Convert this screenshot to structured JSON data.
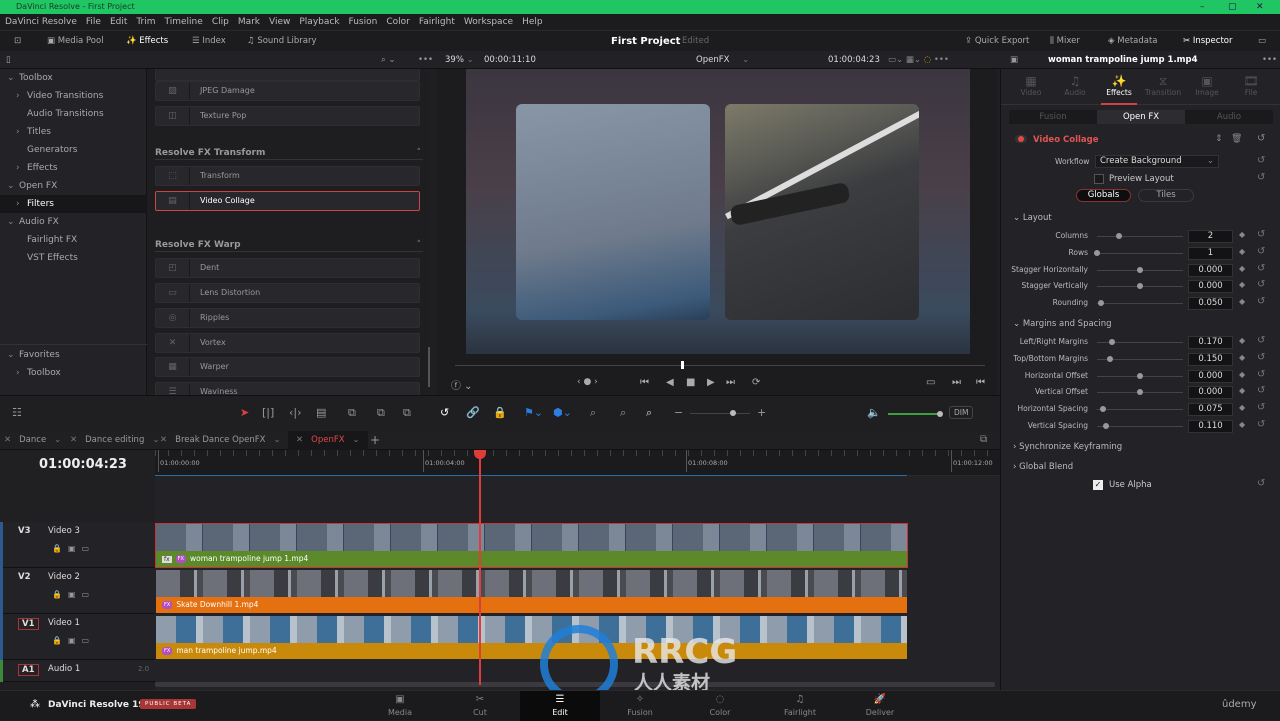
{
  "window": {
    "title": "DaVinci Resolve - First Project",
    "accent": "#1fc663"
  },
  "menu": [
    "DaVinci Resolve",
    "File",
    "Edit",
    "Trim",
    "Timeline",
    "Clip",
    "Mark",
    "View",
    "Playback",
    "Fusion",
    "Color",
    "Fairlight",
    "Workspace",
    "Help"
  ],
  "toolbar": {
    "media_pool": "Media Pool",
    "effects": "Effects",
    "index": "Index",
    "sound_library": "Sound Library",
    "project": "First Project",
    "status": "Edited",
    "quick_export": "Quick Export",
    "mixer": "Mixer",
    "metadata": "Metadata",
    "inspector": "Inspector"
  },
  "viewer_bar": {
    "zoom": "39%",
    "source_tc": "00:00:11:10",
    "timeline_name": "OpenFX",
    "record_tc": "01:00:04:23"
  },
  "tree": [
    {
      "label": "Toolbox",
      "arrow": "⌄",
      "indent": 0
    },
    {
      "label": "Video Transitions",
      "arrow": "›",
      "indent": 1
    },
    {
      "label": "Audio Transitions",
      "arrow": "",
      "indent": 1
    },
    {
      "label": "Titles",
      "arrow": "›",
      "indent": 1
    },
    {
      "label": "Generators",
      "arrow": "",
      "indent": 1
    },
    {
      "label": "Effects",
      "arrow": "›",
      "indent": 1
    },
    {
      "label": "Open FX",
      "arrow": "⌄",
      "indent": 0
    },
    {
      "label": "Filters",
      "arrow": "›",
      "indent": 1,
      "selected": true
    },
    {
      "label": "Audio FX",
      "arrow": "⌄",
      "indent": 0
    },
    {
      "label": "Fairlight FX",
      "arrow": "",
      "indent": 1
    },
    {
      "label": "VST Effects",
      "arrow": "",
      "indent": 1
    }
  ],
  "favorites": {
    "label": "Favorites",
    "items": [
      "Toolbox"
    ]
  },
  "fx": {
    "top_items": [
      "JPEG Damage",
      "Texture Pop"
    ],
    "groups": [
      {
        "title": "Resolve FX Transform",
        "items": [
          "Transform",
          "Video Collage"
        ]
      },
      {
        "title": "Resolve FX Warp",
        "items": [
          "Dent",
          "Lens Distortion",
          "Ripples",
          "Vortex",
          "Warper",
          "Waviness"
        ]
      }
    ],
    "selected": "Video Collage"
  },
  "inspector": {
    "clip": "woman trampoline jump 1.mp4",
    "tabs": [
      {
        "label": "Video",
        "icon": "▦"
      },
      {
        "label": "Audio",
        "icon": "♫"
      },
      {
        "label": "Effects",
        "icon": "✨",
        "active": true
      },
      {
        "label": "Transition",
        "icon": "⧖"
      },
      {
        "label": "Image",
        "icon": "▣"
      },
      {
        "label": "File",
        "icon": "🎞"
      }
    ],
    "subtabs": [
      "Fusion",
      "Open FX",
      "Audio"
    ],
    "effect": "Video Collage",
    "workflow_label": "Workflow",
    "workflow": "Create Background",
    "preview_layout": "Preview Layout",
    "mode_buttons": [
      "Globals",
      "Tiles"
    ],
    "layout_title": "Layout",
    "layout": [
      {
        "label": "Columns",
        "value": "2",
        "pos": 0.25
      },
      {
        "label": "Rows",
        "value": "1",
        "pos": 0
      },
      {
        "label": "Stagger Horizontally",
        "value": "0.000",
        "pos": 0.5
      },
      {
        "label": "Stagger Vertically",
        "value": "0.000",
        "pos": 0.5
      },
      {
        "label": "Rounding",
        "value": "0.050",
        "pos": 0.05
      }
    ],
    "margins_title": "Margins and Spacing",
    "margins": [
      {
        "label": "Left/Right Margins",
        "value": "0.170",
        "pos": 0.17
      },
      {
        "label": "Top/Bottom Margins",
        "value": "0.150",
        "pos": 0.15
      },
      {
        "label": "Horizontal Offset",
        "value": "0.000",
        "pos": 0.5
      },
      {
        "label": "Vertical Offset",
        "value": "0.000",
        "pos": 0.5
      },
      {
        "label": "Horizontal Spacing",
        "value": "0.075",
        "pos": 0.075
      },
      {
        "label": "Vertical Spacing",
        "value": "0.110",
        "pos": 0.11
      }
    ],
    "sync": "Synchronize Keyframing",
    "blend": "Global Blend",
    "use_alpha": "Use Alpha"
  },
  "timeline": {
    "tabs": [
      "Dance",
      "Dance editing",
      "Break Dance OpenFX",
      "OpenFX"
    ],
    "active_tab": "OpenFX",
    "timecode": "01:00:04:23",
    "ruler": [
      "01:00:00:00",
      "01:00:04:00",
      "01:00:08:00",
      "01:00:12:00"
    ],
    "dim": "DIM",
    "tracks": [
      {
        "id": "V3",
        "name": "Video 3",
        "clip": "woman trampoline jump 1.mp4",
        "color": "#5c8a2a",
        "fx": "fx"
      },
      {
        "id": "V2",
        "name": "Video 2",
        "clip": "Skate Downhill 1.mp4",
        "color": "#e5700f"
      },
      {
        "id": "V1",
        "name": "Video 1",
        "clip": "man trampoline jump.mp4",
        "color": "#c98a0c"
      }
    ],
    "audio": {
      "id": "A1",
      "name": "Audio 1",
      "channels": "2.0"
    }
  },
  "pages": [
    "Media",
    "Cut",
    "Edit",
    "Fusion",
    "Color",
    "Fairlight",
    "Deliver"
  ],
  "active_page": "Edit",
  "brand": {
    "name": "DaVinci Resolve 19",
    "beta": "PUBLIC BETA",
    "watermark": "RRCG",
    "watermark_sub": "人人素材",
    "udemy": "ûdemy"
  }
}
